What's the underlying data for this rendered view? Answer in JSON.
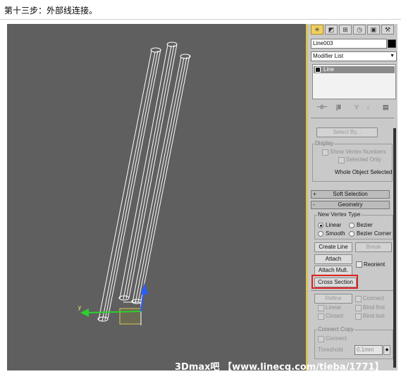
{
  "caption": "第十三步：外部线连接。",
  "panel": {
    "tabs": [
      "✳",
      "◩",
      "⊞",
      "◷",
      "▣",
      "⚒"
    ],
    "object_name": "Line003",
    "modifier_list": "Modifier List",
    "stack_item": "Line",
    "selection": {
      "select_by_label": "Select By...",
      "display_label": "Display",
      "show_vertex_numbers_label": "Show Vertex Numbers",
      "selected_only_label": "Selected Only",
      "status_text": "Whole Object Selected"
    },
    "soft_selection_label": "Soft Selection",
    "geometry_label": "Geometry",
    "vertex_type": {
      "title": "New Vertex Type",
      "linear_label": "Linear",
      "bezier_label": "Bezier",
      "smooth_label": "Smooth",
      "bezier_corner_label": "Bezier Corner"
    },
    "buttons": {
      "create_line": "Create Line",
      "break": "Break",
      "attach": "Attach",
      "reorient": "Reorient",
      "attach_mult": "Attach Mult.",
      "cross_section": "Cross Section",
      "refine": "Refine",
      "connect": "Connect",
      "linear": "Linear",
      "bind_first": "Bind first",
      "closed": "Closed",
      "bind_last": "Bind last"
    },
    "connect_copy": {
      "title": "Connect Copy",
      "connect_label": "Connect",
      "threshold_label": "Threshold",
      "threshold_value": "0.1mm"
    }
  },
  "viewport": {
    "axis_y": "y"
  },
  "watermark": "3Dmax吧 【www.linecg.com/tieba/1771】",
  "colors": {
    "highlight": "#e02020",
    "accent": "#f0d060",
    "viewport_bg": "#5f5f5f"
  }
}
